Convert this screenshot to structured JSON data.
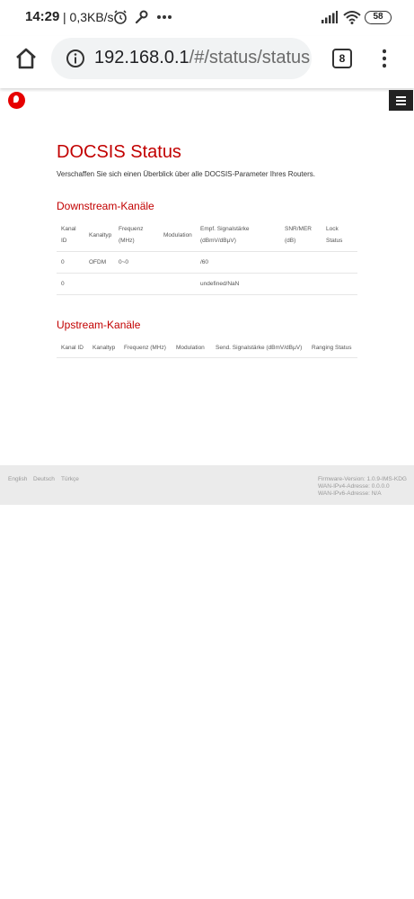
{
  "status_bar": {
    "time": "14:29",
    "speed": "| 0,3KB/s",
    "battery": "58",
    "icons": [
      "alarm-icon",
      "wrench-icon",
      "more-dots-icon",
      "signal-icon",
      "wifi-icon",
      "battery-icon"
    ]
  },
  "browser": {
    "url_host": "192.168.0.1",
    "url_rest": "/#/status/status",
    "tab_count": "8"
  },
  "page": {
    "title": "DOCSIS Status",
    "intro": "Verschaffen Sie sich einen Überblick über alle DOCSIS-Parameter Ihres Routers."
  },
  "downstream": {
    "title": "Downstream-Kanäle",
    "headers": {
      "kanal_id_1": "Kanal",
      "kanal_id_2": "ID",
      "kanaltyp": "Kanaltyp",
      "frequenz_1": "Frequenz",
      "frequenz_2": "(MHz)",
      "modulation": "Modulation",
      "signal_1": "Empf. Signalstärke",
      "signal_2": "(dBmV/dBµV)",
      "snr_1": "SNR/MER",
      "snr_2": "(dB)",
      "lock_1": "Lock",
      "lock_2": "Status"
    },
    "rows": [
      {
        "kanal_id": "0",
        "kanaltyp": "OFDM",
        "frequenz": "0~0",
        "modulation": "",
        "signal": "/60",
        "snr": "",
        "lock": ""
      },
      {
        "kanal_id": "0",
        "kanaltyp": "",
        "frequenz": "",
        "modulation": "",
        "signal": "undefined/NaN",
        "snr": "",
        "lock": ""
      }
    ]
  },
  "upstream": {
    "title": "Upstream-Kanäle",
    "headers": {
      "kanal_id": "Kanal ID",
      "kanaltyp": "Kanaltyp",
      "frequenz": "Frequenz (MHz)",
      "modulation": "Modulation",
      "signal": "Send. Signalstärke (dBmV/dBµV)",
      "ranging": "Ranging Status"
    }
  },
  "footer": {
    "languages": [
      "English",
      "Deutsch",
      "Türkçe"
    ],
    "firmware": "Firmware-Version: 1.0.9-IMS-KDG",
    "wan_ipv4": "WAN-IPv4-Adresse: 0.0.0.0",
    "wan_ipv6": "WAN-IPv6-Adresse: N/A"
  },
  "colors": {
    "brand_red": "#e60000",
    "heading_red": "#c20000",
    "footer_bg": "#ebebeb"
  }
}
